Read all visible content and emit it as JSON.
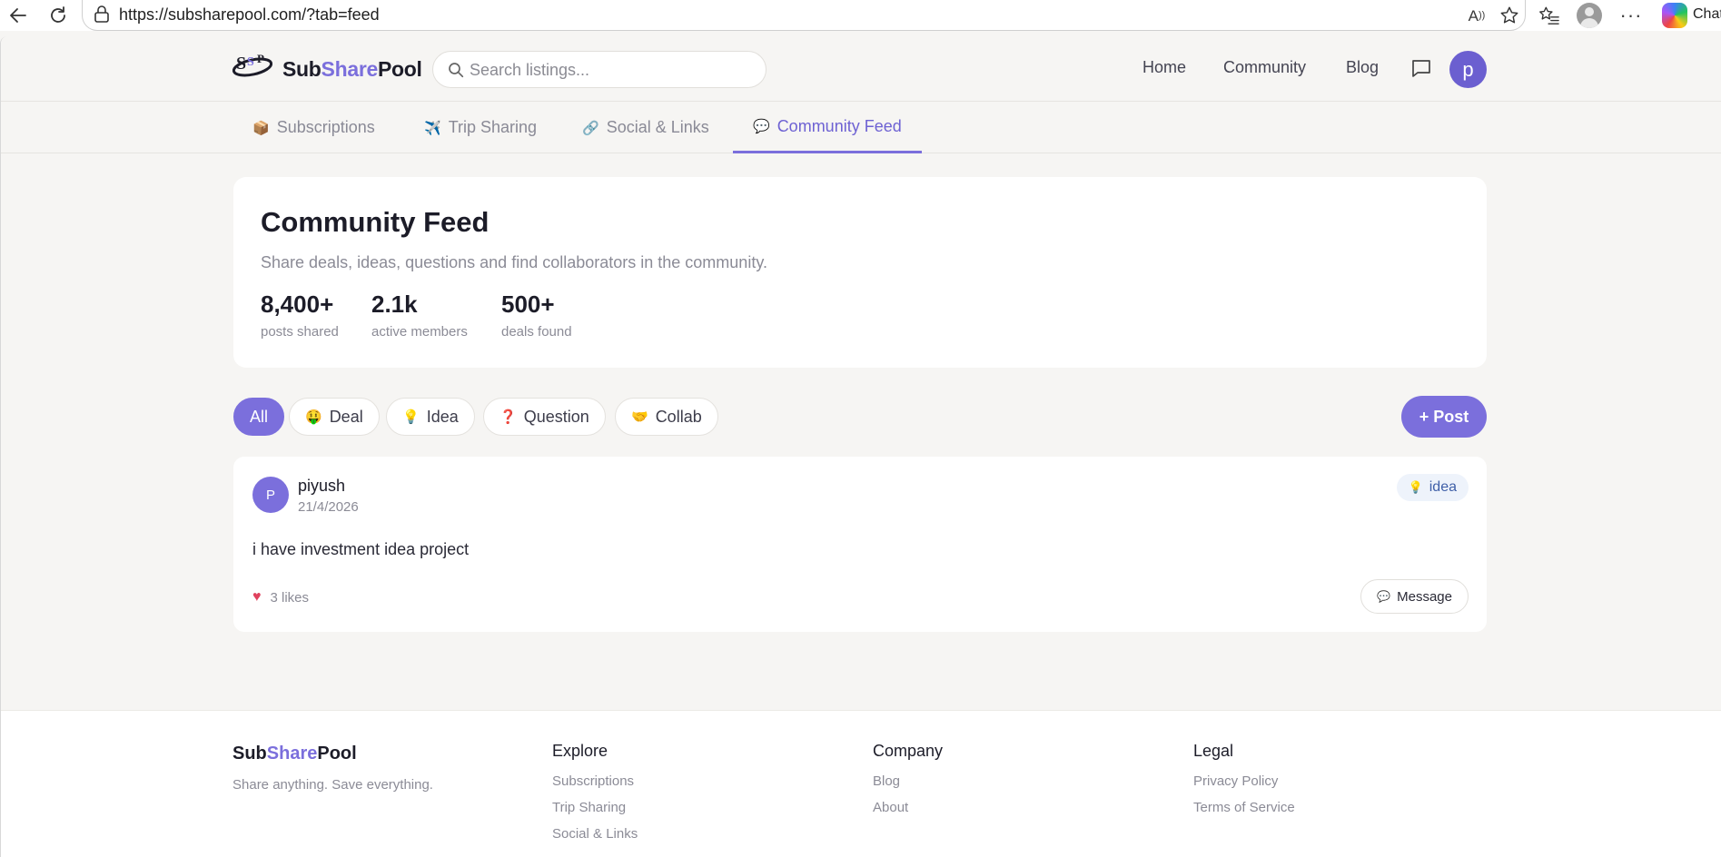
{
  "browser": {
    "url": "https://subsharepool.com/?tab=feed",
    "copilot_label": "Chat"
  },
  "header": {
    "brand_prefix": "Sub",
    "brand_accent": "Share",
    "brand_suffix": "Pool",
    "search_placeholder": "Search listings...",
    "nav": {
      "home": "Home",
      "community": "Community",
      "blog": "Blog"
    },
    "user_initial": "p"
  },
  "tabs": [
    {
      "emoji": "📦",
      "label": "Subscriptions"
    },
    {
      "emoji": "✈️",
      "label": "Trip Sharing"
    },
    {
      "emoji": "🔗",
      "label": "Social & Links"
    },
    {
      "emoji": "💬",
      "label": "Community Feed",
      "active": true
    }
  ],
  "hero": {
    "title": "Community Feed",
    "subtitle": "Share deals, ideas, questions and find collaborators in the community.",
    "stats": [
      {
        "value": "8,400+",
        "label": "posts shared"
      },
      {
        "value": "2.1k",
        "label": "active members"
      },
      {
        "value": "500+",
        "label": "deals found"
      }
    ]
  },
  "filters": {
    "all": "All",
    "items": [
      {
        "emoji": "🤑",
        "label": "Deal"
      },
      {
        "emoji": "💡",
        "label": "Idea"
      },
      {
        "emoji": "❓",
        "label": "Question"
      },
      {
        "emoji": "🤝",
        "label": "Collab"
      }
    ],
    "post_button": "+ Post"
  },
  "post": {
    "avatar_initial": "P",
    "author": "piyush",
    "date": "21/4/2026",
    "badge_emoji": "💡",
    "badge_label": "idea",
    "text": "i have investment idea project",
    "likes_label": "3 likes",
    "message_emoji": "💬",
    "message_label": "Message"
  },
  "footer": {
    "brand_prefix": "Sub",
    "brand_accent": "Share",
    "brand_suffix": "Pool",
    "tagline": "Share anything. Save everything.",
    "explore": {
      "title": "Explore",
      "links": [
        "Subscriptions",
        "Trip Sharing",
        "Social & Links"
      ]
    },
    "company": {
      "title": "Company",
      "links": [
        "Blog",
        "About"
      ]
    },
    "legal": {
      "title": "Legal",
      "links": [
        "Privacy Policy",
        "Terms of Service"
      ]
    }
  },
  "colors": {
    "accent": "#7b6fdc",
    "avatar": "#6b5fd0",
    "background": "#f6f5f3",
    "badge_bg": "#eef3fb",
    "badge_text": "#3f5fa8",
    "heart": "#e0425e"
  },
  "icons": {
    "browser": [
      "back-arrow-icon",
      "refresh-icon",
      "lock-icon",
      "read-aloud-icon",
      "favorite-star-icon",
      "favorites-list-icon",
      "profile-icon",
      "more-icon",
      "copilot-icon"
    ],
    "site": [
      "logo-icon",
      "search-icon",
      "chat-bubble-icon",
      "heart-icon"
    ]
  }
}
